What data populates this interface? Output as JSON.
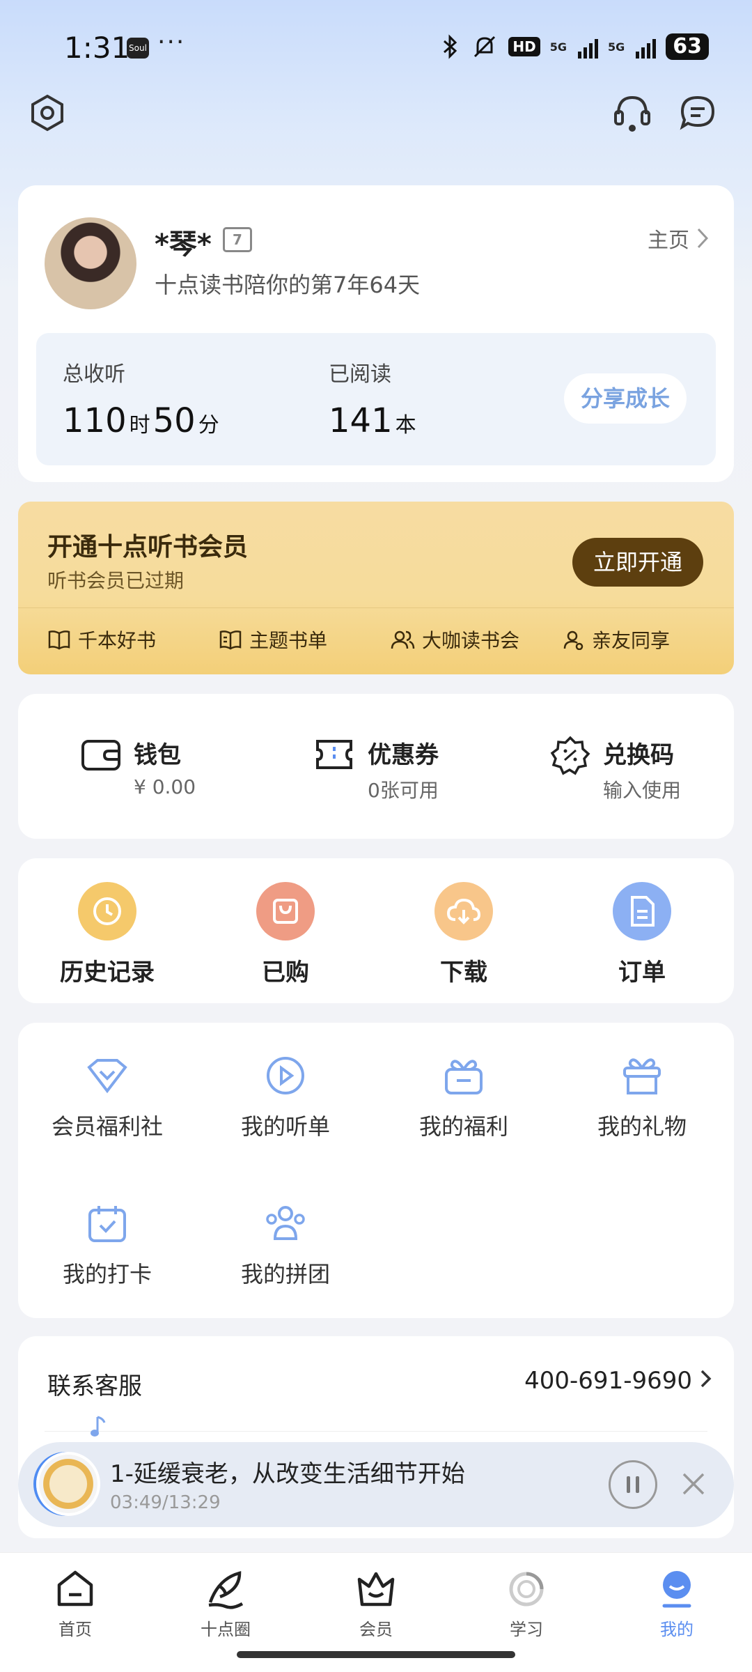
{
  "status": {
    "time": "1:31",
    "app_badge": "Soul",
    "more": "···",
    "hd": "HD",
    "net1": "5G",
    "net2": "5G",
    "battery": "63"
  },
  "profile": {
    "name": "*琴*",
    "days": "十点读书陪你的第7年64天",
    "home_link": "主页",
    "listen_label": "总收听",
    "listen_hours": "110",
    "hour_unit": "时",
    "listen_minutes": "50",
    "minute_unit": "分",
    "read_label": "已阅读",
    "read_count": "141",
    "read_unit": "本",
    "share_button": "分享成长"
  },
  "vip": {
    "title": "开通十点听书会员",
    "subtitle": "听书会员已过期",
    "button": "立即开通",
    "features": [
      "千本好书",
      "主题书单",
      "大咖读书会",
      "亲友同享"
    ]
  },
  "wallet": [
    {
      "title": "钱包",
      "sub": "¥ 0.00",
      "icon": "wallet-icon"
    },
    {
      "title": "优惠券",
      "sub": "0张可用",
      "icon": "coupon-icon"
    },
    {
      "title": "兑换码",
      "sub": "输入使用",
      "icon": "redeem-icon"
    }
  ],
  "quick": [
    {
      "label": "历史记录",
      "icon": "clock-icon",
      "color": "#f5c96b"
    },
    {
      "label": "已购",
      "icon": "bag-icon",
      "color": "#ef9c84"
    },
    {
      "label": "下载",
      "icon": "cloud-download-icon",
      "color": "#f8c68a"
    },
    {
      "label": "订单",
      "icon": "document-icon",
      "color": "#8cb0f3"
    }
  ],
  "services": [
    {
      "label": "会员福利社",
      "icon": "diamond-icon"
    },
    {
      "label": "我的听单",
      "icon": "play-circle-icon"
    },
    {
      "label": "我的福利",
      "icon": "gift-box-icon"
    },
    {
      "label": "我的礼物",
      "icon": "gift-icon"
    },
    {
      "label": "我的打卡",
      "icon": "calendar-check-icon"
    },
    {
      "label": "我的拼团",
      "icon": "group-icon"
    }
  ],
  "contact": {
    "label": "联系客服",
    "phone": "400-691-9690"
  },
  "player": {
    "title": "1-延缓衰老，从改变生活细节开始",
    "time": "03:49/13:29"
  },
  "tabs": [
    {
      "label": "首页",
      "icon": "home-icon"
    },
    {
      "label": "十点圈",
      "icon": "feather-icon"
    },
    {
      "label": "会员",
      "icon": "crown-icon"
    },
    {
      "label": "学习",
      "icon": "progress-ring-icon"
    },
    {
      "label": "我的",
      "icon": "profile-face-icon"
    }
  ],
  "colors": {
    "accent": "#5b8ef0",
    "vip_button": "#5d3f0f",
    "share_text": "#7aa3e0"
  }
}
